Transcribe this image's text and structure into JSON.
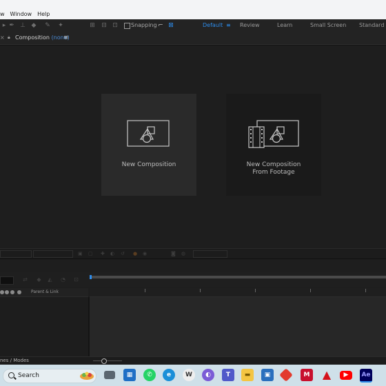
{
  "menubar": {
    "items": [
      "w",
      "Window",
      "Help"
    ]
  },
  "toolbar": {
    "snapping_label": "Snapping",
    "workspaces": [
      "Default",
      "Review",
      "Learn",
      "Small Screen",
      "Standard"
    ],
    "active_workspace": "Default",
    "workspace_menu": "≡"
  },
  "panel": {
    "title": "Composition",
    "comp_name": "(none)",
    "menu_glyph": "≡"
  },
  "cards": {
    "new_composition": "New Composition",
    "from_footage_line1": "New Composition",
    "from_footage_line2": "From Footage"
  },
  "timeline": {
    "column_label": "Parent & Link",
    "switches_label": "nes / Modes"
  },
  "taskbar": {
    "search_label": "Search",
    "active_app": "Ae"
  },
  "colors": {
    "accent": "#2d8ceb",
    "panel_bg": "#1e1e1e",
    "card_bg": "#2a2a2a"
  }
}
